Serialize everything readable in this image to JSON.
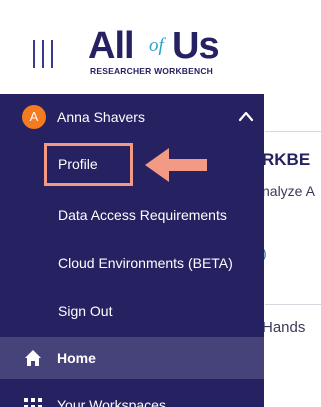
{
  "brand": {
    "logo_all": "All",
    "logo_of": "of",
    "logo_us": "Us",
    "logo_subtitle": "RESEARCHER WORKBENCH",
    "primary_color": "#262262",
    "accent_color": "#2d9fd0"
  },
  "header": {
    "menu_icon": "hamburger-icon"
  },
  "user": {
    "initial": "A",
    "name": "Anna Shavers",
    "avatar_color": "#f47b20",
    "caret_icon": "chevron-up-icon"
  },
  "account_menu": {
    "items": [
      {
        "label": "Profile",
        "highlighted": true
      },
      {
        "label": "Data Access Requirements"
      },
      {
        "label": "Cloud Environments (BETA)"
      },
      {
        "label": "Sign Out"
      }
    ],
    "highlight_color": "#f29a84"
  },
  "nav": {
    "home": {
      "label": "Home",
      "icon": "home-icon"
    },
    "workspaces": {
      "label": "Your Workspaces",
      "icon": "grid-icon"
    }
  },
  "background": {
    "title_fragment": "RKBE",
    "subtitle_fragment": "nalyze A",
    "chip_fragment": ")",
    "hands_fragment": "Hands"
  }
}
